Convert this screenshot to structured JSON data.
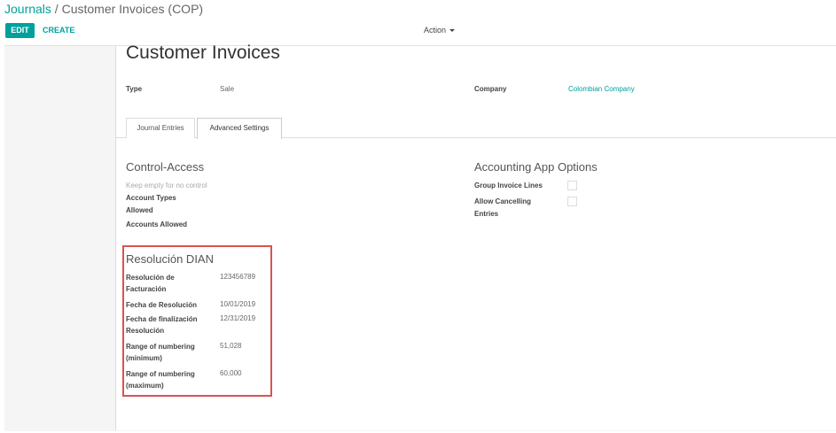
{
  "breadcrumb": {
    "parent": "Journals",
    "separator": " / ",
    "current": "Customer Invoices (COP)"
  },
  "toolbar": {
    "edit_label": "EDIT",
    "create_label": "CREATE",
    "action_label": "Action"
  },
  "form": {
    "title": "Customer Invoices",
    "type_label": "Type",
    "type_value": "Sale",
    "company_label": "Company",
    "company_value": "Colombian Company"
  },
  "tabs": [
    {
      "label": "Journal Entries"
    },
    {
      "label": "Advanced Settings"
    }
  ],
  "control_access": {
    "title": "Control-Access",
    "hint": "Keep empty for no control",
    "account_types_label": [
      "Account Types",
      "Allowed"
    ],
    "accounts_allowed_label": "Accounts Allowed"
  },
  "accounting_options": {
    "title": "Accounting App Options",
    "group_invoice_lines_label": "Group Invoice Lines",
    "allow_cancelling_label": [
      "Allow Cancelling",
      "Entries"
    ]
  },
  "dian": {
    "title": "Resolución DIAN",
    "resolucion_label": [
      "Resolución de",
      "Facturación"
    ],
    "resolucion_value": "123456789",
    "fecha_resolucion_label": "Fecha de Resolución",
    "fecha_resolucion_value": "10/01/2019",
    "fecha_final_label": [
      "Fecha de finalización",
      "Resolución"
    ],
    "fecha_final_value": "12/31/2019",
    "range_min_label": [
      "Range of numbering",
      "(minimum)"
    ],
    "range_min_value": "51,028",
    "range_max_label": [
      "Range of numbering",
      "(maximum)"
    ],
    "range_max_value": "60,000"
  },
  "colors": {
    "accent": "#00A09D",
    "highlight": "#d9534f"
  }
}
